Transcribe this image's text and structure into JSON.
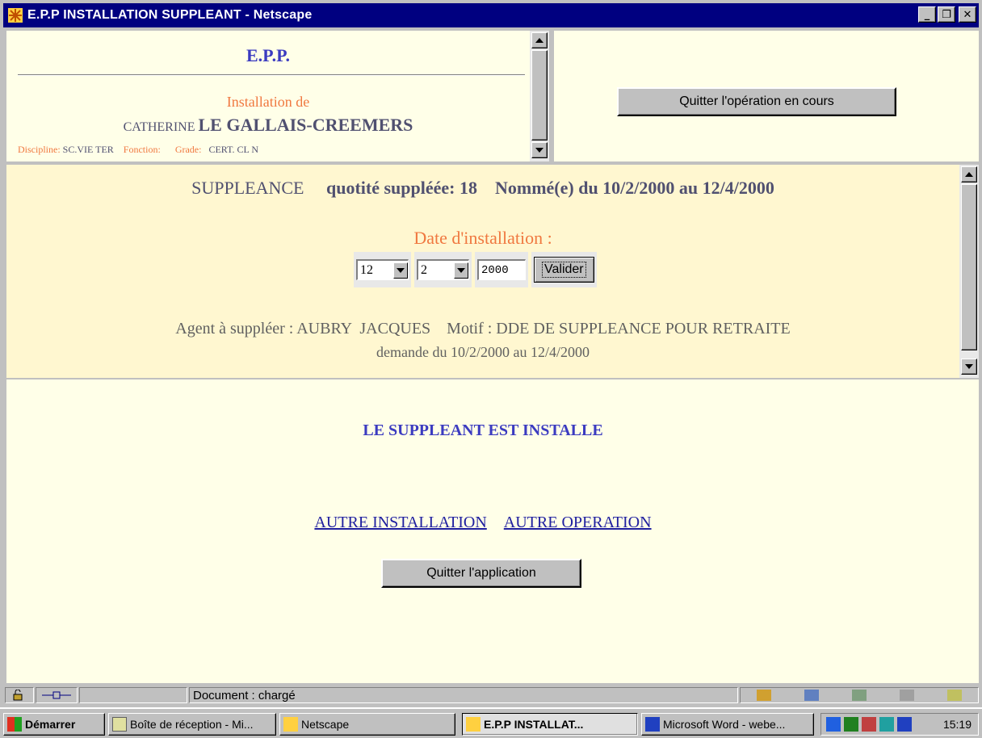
{
  "window": {
    "title": "E.P.P INSTALLATION SUPPLEANT - Netscape",
    "controls": {
      "minimize": "_",
      "maximize": "❐",
      "close": "✕"
    }
  },
  "header_frame": {
    "title": "E.P.P.",
    "install_label": "Installation de",
    "first_name": "CATHERINE",
    "last_name": "LE GALLAIS-CREEMERS",
    "discipline_label": "Discipline:",
    "discipline_value": "SC.VIE TER",
    "fonction_label": "Fonction:",
    "fonction_value": "",
    "grade_label": "Grade:",
    "grade_value": "CERT. CL N"
  },
  "right_frame": {
    "quit_operation_label": "Quitter l'opération en cours"
  },
  "suppleance_frame": {
    "type": "SUPPLEANCE",
    "quotite_label": "quotité suppléée: 18",
    "nomme_label": "Nommé(e) du 10/2/2000 au 12/4/2000",
    "date_label": "Date d'installation :",
    "day_value": "12",
    "month_value": "2",
    "year_value": "2000",
    "valider_label": "Valider",
    "agent_line": "Agent à suppléer : AUBRY  JACQUES    Motif : DDE DE SUPPLEANCE POUR RETRAITE",
    "demande_line": "demande du 10/2/2000 au 12/4/2000"
  },
  "result_frame": {
    "message": "LE SUPPLEANT EST INSTALLE",
    "link_autre_installation": "AUTRE INSTALLATION",
    "link_autre_operation": "AUTRE OPERATION",
    "quit_app_label": "Quitter l'application"
  },
  "statusbar": {
    "text": "Document : chargé"
  },
  "taskbar": {
    "start_label": "Démarrer",
    "items": [
      {
        "label": "Boîte de réception - Mi..."
      },
      {
        "label": "Netscape"
      },
      {
        "label": "E.P.P INSTALLAT..."
      },
      {
        "label": "Microsoft Word - webe..."
      }
    ],
    "clock": "15:19"
  },
  "colors": {
    "titlebar": "#000080",
    "frame_bg": "#ffffe8",
    "mid_bg": "#fff7d0",
    "accent_orange": "#f07840",
    "accent_blue": "#3b3bc0"
  }
}
